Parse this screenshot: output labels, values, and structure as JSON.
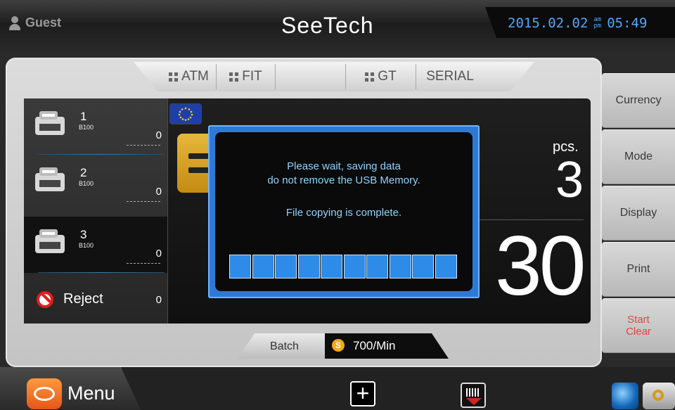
{
  "header": {
    "user": "Guest",
    "logo": "SeeTech",
    "date": "2015.02.02",
    "am": "am",
    "pm": "pm",
    "time": "05:49"
  },
  "tabs": [
    {
      "label": "ATM",
      "icon": "grid-icon"
    },
    {
      "label": "FIT",
      "icon": "grid-icon"
    },
    {
      "label": "",
      "icon": ""
    },
    {
      "label": "GT",
      "icon": "grid-icon"
    },
    {
      "label": "SERIAL",
      "icon": ""
    }
  ],
  "pockets": [
    {
      "number": "1",
      "denomination": "B100",
      "count": "0"
    },
    {
      "number": "2",
      "denomination": "B100",
      "count": "0"
    },
    {
      "number": "3",
      "denomination": "B100",
      "count": "0"
    }
  ],
  "reject": {
    "label": "Reject",
    "count": "0"
  },
  "counter": {
    "pcs_label": "pcs.",
    "pieces": "3",
    "total": "30"
  },
  "dialog": {
    "line1": "Please wait, saving data",
    "line2": "do not remove the USB Memory.",
    "line3": "File copying is complete.",
    "progress": 1.0,
    "segments": 10
  },
  "status": {
    "mode": "Batch",
    "speed_icon": "S",
    "speed": "700/Min"
  },
  "side_buttons": [
    {
      "label": "Currency"
    },
    {
      "label": "Mode"
    },
    {
      "label": "Display"
    },
    {
      "label": "Print"
    },
    {
      "label": "Start",
      "label2": "Clear"
    }
  ],
  "bottom": {
    "menu_label": "Menu",
    "plus_label": "+"
  },
  "colors": {
    "accent_blue": "#4da9ff",
    "dialog_text": "#8fd3ff",
    "start_red": "#e04646"
  }
}
